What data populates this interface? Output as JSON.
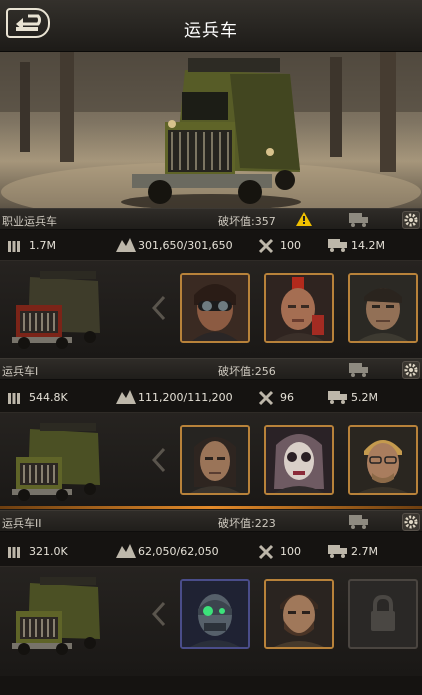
{
  "header": {
    "title": "运兵车",
    "back_icon": "back-arrow-icon"
  },
  "hero": {
    "image": "armored-truck-hero"
  },
  "sections": [
    {
      "name": "职业运兵车",
      "damage": "破坏值:357",
      "warning": true,
      "stats": {
        "troops": "1.7M",
        "hp": "301,650/301,650",
        "repair": "100",
        "load": "14.2M"
      },
      "heroes": [
        "hero-goggles-woman",
        "hero-mohawk-man",
        "hero-scarred-man"
      ]
    },
    {
      "name": "运兵车I",
      "damage": "破坏值:256",
      "warning": false,
      "stats": {
        "troops": "544.8K",
        "hp": "111,200/111,200",
        "repair": "96",
        "load": "5.2M"
      },
      "heroes": [
        "hero-long-hair-man",
        "hero-skull-woman",
        "hero-blond-man"
      ]
    },
    {
      "name": "运兵车II",
      "damage": "破坏值:223",
      "warning": false,
      "stats": {
        "troops": "321.0K",
        "hp": "62,050/62,050",
        "repair": "100",
        "load": "2.7M"
      },
      "heroes": [
        "hero-cyber-mask",
        "hero-bearded-man",
        "locked-slot"
      ]
    }
  ],
  "colors": {
    "accent": "#e28a2a",
    "frame": "#b8823a",
    "warning": "#f0c000"
  }
}
